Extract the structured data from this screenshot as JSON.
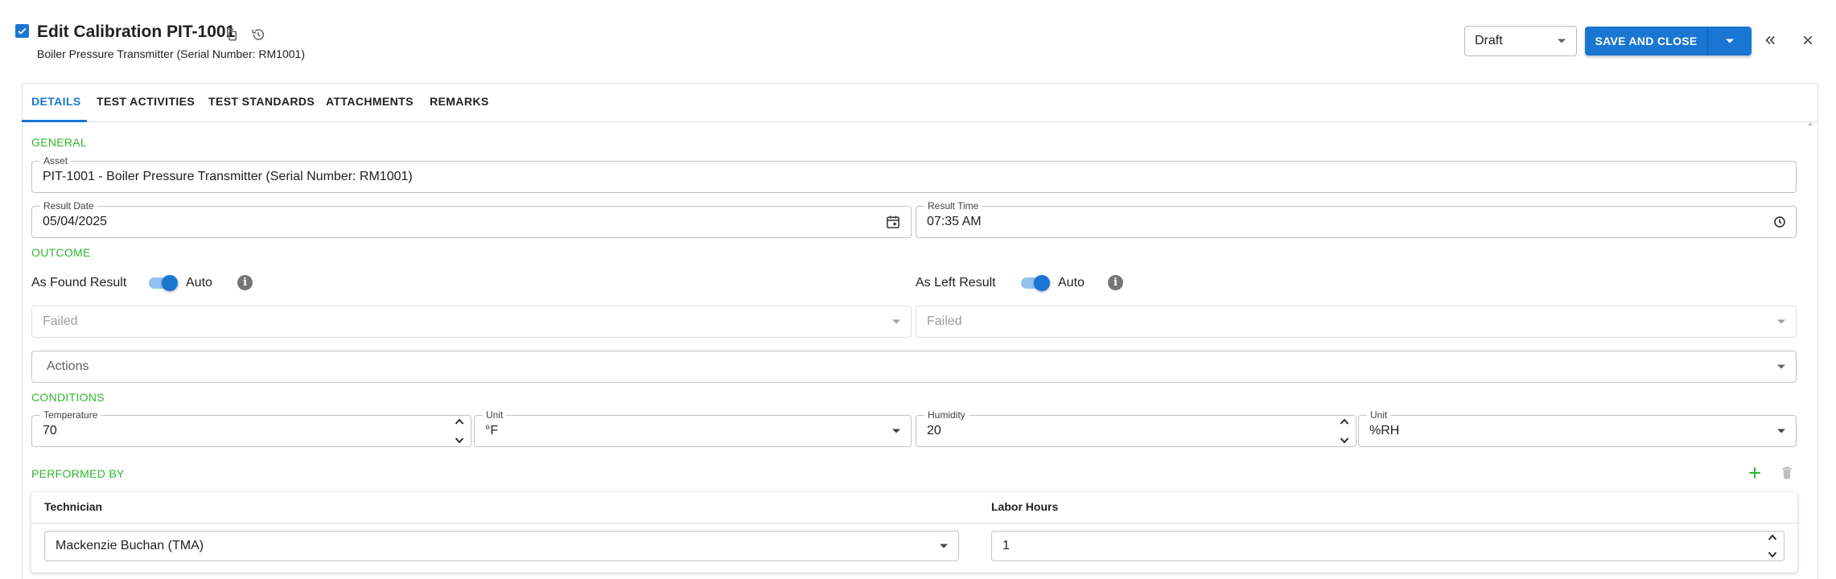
{
  "header": {
    "title": "Edit Calibration PIT-1001",
    "subtitle": "Boiler Pressure Transmitter (Serial Number: RM1001)",
    "status": "Draft",
    "save_label": "SAVE AND CLOSE"
  },
  "tabs": [
    {
      "label": "DETAILS",
      "active": true
    },
    {
      "label": "TEST ACTIVITIES"
    },
    {
      "label": "TEST STANDARDS"
    },
    {
      "label": "ATTACHMENTS"
    },
    {
      "label": "REMARKS"
    }
  ],
  "general": {
    "section": "GENERAL",
    "asset_label": "Asset",
    "asset_value": "PIT-1001 - Boiler Pressure Transmitter (Serial Number: RM1001)",
    "result_date_label": "Result Date",
    "result_date_value": "05/04/2025",
    "result_time_label": "Result Time",
    "result_time_value": "07:35 AM"
  },
  "outcome": {
    "section": "OUTCOME",
    "as_found_label": "As Found Result",
    "as_found_toggle": "Auto",
    "as_found_value": "Failed",
    "as_left_label": "As Left Result",
    "as_left_toggle": "Auto",
    "as_left_value": "Failed",
    "actions_placeholder": "Actions"
  },
  "conditions": {
    "section": "CONDITIONS",
    "temperature_label": "Temperature",
    "temperature_value": "70",
    "temp_unit_label": "Unit",
    "temp_unit_value": "°F",
    "humidity_label": "Humidity",
    "humidity_value": "20",
    "humidity_unit_label": "Unit",
    "humidity_unit_value": "%RH"
  },
  "performed_by": {
    "section": "PERFORMED BY",
    "col_technician": "Technician",
    "col_labor_hours": "Labor Hours",
    "rows": [
      {
        "technician": "Mackenzie Buchan (TMA)",
        "labor_hours": "1"
      }
    ]
  },
  "colors": {
    "primary": "#1976d2",
    "section_green": "#2eb82e",
    "add_green": "#2eb82e"
  },
  "icons": [
    "checkbox-icon",
    "copy-icon",
    "history-icon",
    "chevron-down-icon",
    "double-chevron-left-icon",
    "close-icon",
    "calendar-icon",
    "clock-icon",
    "info-icon",
    "plus-icon",
    "trash-icon"
  ]
}
